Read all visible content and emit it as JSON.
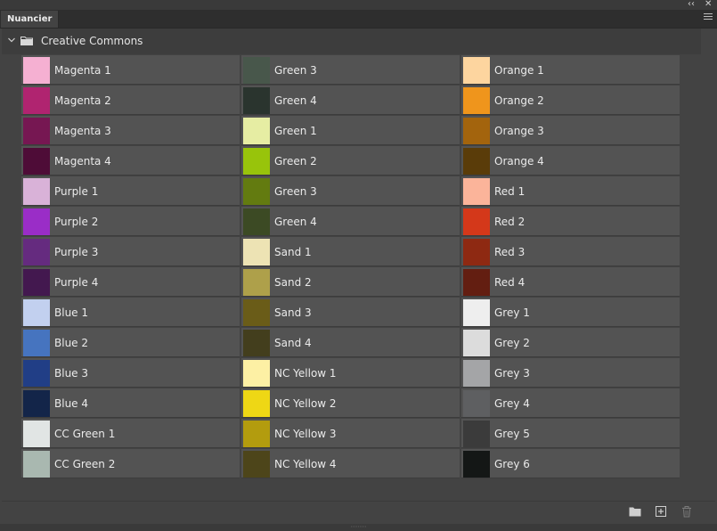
{
  "panel": {
    "tab_label": "Nuancier",
    "collapse_glyph": "‹‹",
    "close_glyph": "✕"
  },
  "group": {
    "name": "Creative Commons",
    "expanded": true
  },
  "swatches": [
    [
      {
        "name": "Magenta 1",
        "color": "#F5B0D2"
      },
      {
        "name": "Magenta 2",
        "color": "#B02470"
      },
      {
        "name": "Magenta 3",
        "color": "#761752"
      },
      {
        "name": "Magenta 4",
        "color": "#4E0C37"
      },
      {
        "name": "Purple 1",
        "color": "#D9B2D8"
      },
      {
        "name": "Purple 2",
        "color": "#9A2DC7"
      },
      {
        "name": "Purple 3",
        "color": "#652B7F"
      },
      {
        "name": "Purple 4",
        "color": "#43184F"
      },
      {
        "name": "Blue 1",
        "color": "#C2D0EF"
      },
      {
        "name": "Blue 2",
        "color": "#4674BF"
      },
      {
        "name": "Blue 3",
        "color": "#213E86"
      },
      {
        "name": "Blue 4",
        "color": "#132549"
      },
      {
        "name": "CC Green 1",
        "color": "#E1E5E4"
      },
      {
        "name": "CC Green 2",
        "color": "#A9B8B0"
      }
    ],
    [
      {
        "name": "Green 3",
        "color": "#48574B"
      },
      {
        "name": "Green 4",
        "color": "#2A342E"
      },
      {
        "name": "Green 1",
        "color": "#E6EDA3"
      },
      {
        "name": "Green 2",
        "color": "#98C40B"
      },
      {
        "name": "Green 3",
        "color": "#637B10"
      },
      {
        "name": "Green 4",
        "color": "#3C4A24"
      },
      {
        "name": "Sand 1",
        "color": "#EDE3B4"
      },
      {
        "name": "Sand 2",
        "color": "#AEA04A"
      },
      {
        "name": "Sand 3",
        "color": "#6A5C18"
      },
      {
        "name": "Sand 4",
        "color": "#433E1D"
      },
      {
        "name": "NC Yellow 1",
        "color": "#FDF0A4"
      },
      {
        "name": "NC Yellow 2",
        "color": "#EED715"
      },
      {
        "name": "NC Yellow 3",
        "color": "#B39C0E"
      },
      {
        "name": "NC Yellow 4",
        "color": "#4D451A"
      }
    ],
    [
      {
        "name": "Orange 1",
        "color": "#FDD59F"
      },
      {
        "name": "Orange 2",
        "color": "#EF951C"
      },
      {
        "name": "Orange 3",
        "color": "#A3640D"
      },
      {
        "name": "Orange 4",
        "color": "#5A3C09"
      },
      {
        "name": "Red 1",
        "color": "#FBB49A"
      },
      {
        "name": "Red 2",
        "color": "#D4381A"
      },
      {
        "name": "Red 3",
        "color": "#8E2912"
      },
      {
        "name": "Red 4",
        "color": "#631E11"
      },
      {
        "name": "Grey 1",
        "color": "#EEEEEE"
      },
      {
        "name": "Grey 2",
        "color": "#DCDCDC"
      },
      {
        "name": "Grey 3",
        "color": "#A4A5A7"
      },
      {
        "name": "Grey 4",
        "color": "#5E5F61"
      },
      {
        "name": "Grey 5",
        "color": "#3B3B3B"
      },
      {
        "name": "Grey 6",
        "color": "#141716"
      }
    ]
  ],
  "toolbar": {
    "icons": [
      "new-group-icon",
      "new-swatch-icon",
      "delete-swatch-icon"
    ]
  }
}
